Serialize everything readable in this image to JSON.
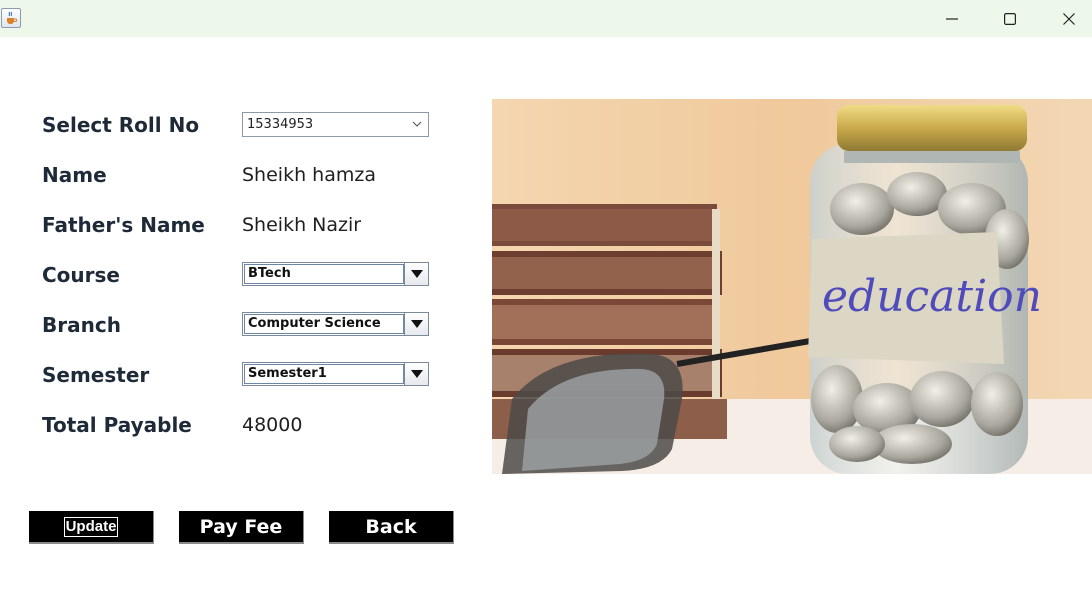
{
  "window": {
    "icon": "java-cup-icon",
    "controls": [
      "minimize-icon",
      "maximize-icon",
      "close-icon"
    ]
  },
  "form": {
    "roll_label": "Select Roll No",
    "roll_value": "15334953",
    "name_label": "Name",
    "name_value": "Sheikh hamza",
    "father_label": "Father's Name",
    "father_value": "Sheikh Nazir",
    "course_label": "Course",
    "course_value": "BTech",
    "branch_label": "Branch",
    "branch_value": "Computer Science",
    "semester_label": "Semester",
    "semester_value": "Semester1",
    "total_label": "Total Payable",
    "total_value": "48000"
  },
  "image": {
    "jar_label": "education"
  },
  "buttons": {
    "update": "Update",
    "pay": "Pay Fee",
    "back": "Back"
  },
  "colors": {
    "titlebar": "#eef8ea",
    "button_bg": "#000000",
    "button_text": "#ffffff",
    "label_text": "#1e2a38"
  }
}
